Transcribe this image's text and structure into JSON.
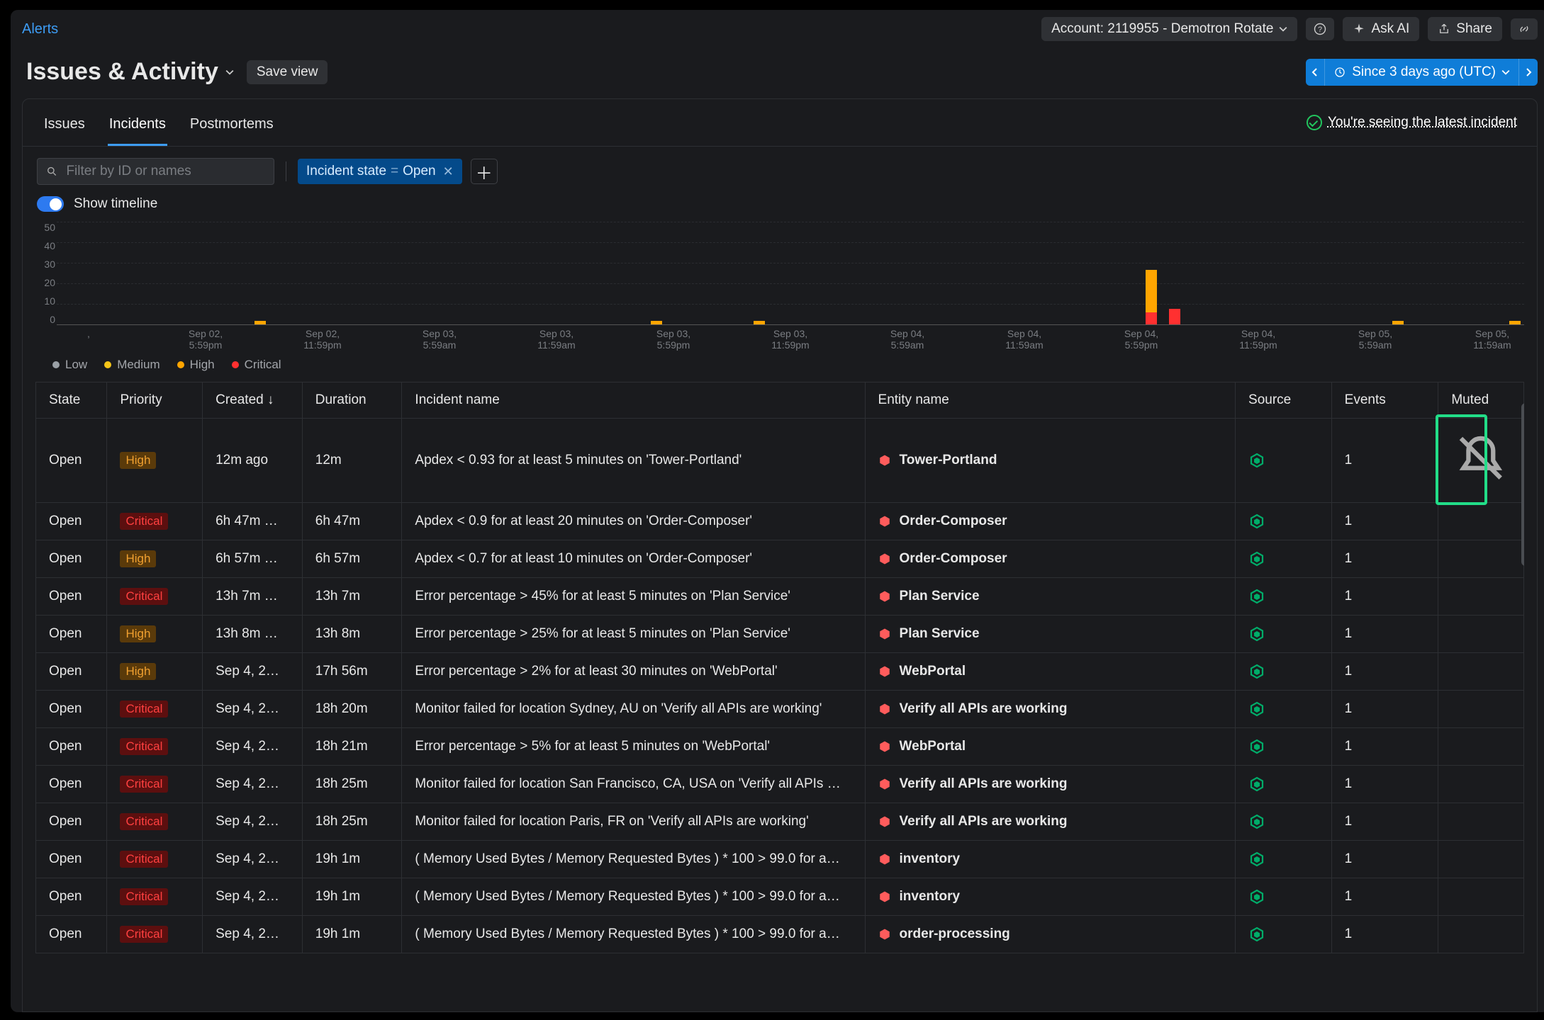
{
  "header": {
    "alerts_link": "Alerts",
    "account_selector": "Account: 2119955 - Demotron Rotate",
    "ask_ai": "Ask AI",
    "share": "Share"
  },
  "title": {
    "page_title": "Issues & Activity",
    "save_view": "Save view",
    "timerange": "Since 3 days ago (UTC)"
  },
  "tabs": {
    "issues": "Issues",
    "incidents": "Incidents",
    "postmortems": "Postmortems",
    "latest_notice": "You're seeing the latest incident"
  },
  "filters": {
    "search_placeholder": "Filter by ID or names",
    "chip_key": "Incident state",
    "chip_op": "=",
    "chip_val": "Open",
    "show_timeline": "Show timeline"
  },
  "chart_data": {
    "type": "bar",
    "y_ticks": [
      "50",
      "40",
      "30",
      "20",
      "10",
      "0"
    ],
    "x_ticks": [
      ",",
      "Sep 02, 5:59pm",
      "Sep 02, 11:59pm",
      "Sep 03, 5:59am",
      "Sep 03, 11:59am",
      "Sep 03, 5:59pm",
      "Sep 03, 11:59pm",
      "Sep 04, 5:59am",
      "Sep 04, 11:59am",
      "Sep 04, 5:59pm",
      "Sep 04, 11:59pm",
      "Sep 05, 5:59am",
      "Sep 05, 11:59am"
    ],
    "bars": [
      {
        "x_pct": 13.5,
        "stacks": [
          {
            "color": "#ffa500",
            "h": 4
          }
        ]
      },
      {
        "x_pct": 40.5,
        "stacks": [
          {
            "color": "#ffa500",
            "h": 4
          }
        ]
      },
      {
        "x_pct": 47.5,
        "stacks": [
          {
            "color": "#ffa500",
            "h": 4
          }
        ]
      },
      {
        "x_pct": 74.2,
        "stacks": [
          {
            "color": "#ffa500",
            "h": 50
          },
          {
            "color": "#ff3030",
            "h": 14
          }
        ]
      },
      {
        "x_pct": 75.8,
        "stacks": [
          {
            "color": "#ff3030",
            "h": 18
          }
        ]
      },
      {
        "x_pct": 91.0,
        "stacks": [
          {
            "color": "#ffa500",
            "h": 4
          }
        ]
      },
      {
        "x_pct": 99.0,
        "stacks": [
          {
            "color": "#ffa500",
            "h": 4
          }
        ]
      }
    ],
    "legend": [
      {
        "color": "#9aa0a6",
        "label": "Low"
      },
      {
        "color": "#f5c518",
        "label": "Medium"
      },
      {
        "color": "#ffa500",
        "label": "High"
      },
      {
        "color": "#ff3030",
        "label": "Critical"
      }
    ]
  },
  "columns": {
    "state": "State",
    "priority": "Priority",
    "created": "Created ↓",
    "duration": "Duration",
    "incident": "Incident name",
    "entity": "Entity name",
    "source": "Source",
    "events": "Events",
    "muted": "Muted"
  },
  "rows": [
    {
      "state": "Open",
      "priority": "High",
      "created": "12m ago",
      "duration": "12m",
      "name": "Apdex < 0.93 for at least 5 minutes on 'Tower-Portland'",
      "entity": "Tower-Portland",
      "events": "1",
      "muted": true
    },
    {
      "state": "Open",
      "priority": "Critical",
      "created": "6h 47m …",
      "duration": "6h 47m",
      "name": "Apdex < 0.9 for at least 20 minutes on 'Order-Composer'",
      "entity": "Order-Composer",
      "events": "1"
    },
    {
      "state": "Open",
      "priority": "High",
      "created": "6h 57m …",
      "duration": "6h 57m",
      "name": "Apdex < 0.7 for at least 10 minutes on 'Order-Composer'",
      "entity": "Order-Composer",
      "events": "1"
    },
    {
      "state": "Open",
      "priority": "Critical",
      "created": "13h 7m …",
      "duration": "13h 7m",
      "name": "Error percentage > 45% for at least 5 minutes on 'Plan Service'",
      "entity": "Plan Service",
      "events": "1"
    },
    {
      "state": "Open",
      "priority": "High",
      "created": "13h 8m …",
      "duration": "13h 8m",
      "name": "Error percentage > 25% for at least 5 minutes on 'Plan Service'",
      "entity": "Plan Service",
      "events": "1"
    },
    {
      "state": "Open",
      "priority": "High",
      "created": "Sep 4, 2…",
      "duration": "17h 56m",
      "name": "Error percentage > 2% for at least 30 minutes on 'WebPortal'",
      "entity": "WebPortal",
      "events": "1"
    },
    {
      "state": "Open",
      "priority": "Critical",
      "created": "Sep 4, 2…",
      "duration": "18h 20m",
      "name": "Monitor failed for location Sydney, AU on 'Verify all APIs are working'",
      "entity": "Verify all APIs are working",
      "events": "1"
    },
    {
      "state": "Open",
      "priority": "Critical",
      "created": "Sep 4, 2…",
      "duration": "18h 21m",
      "name": "Error percentage > 5% for at least 5 minutes on 'WebPortal'",
      "entity": "WebPortal",
      "events": "1"
    },
    {
      "state": "Open",
      "priority": "Critical",
      "created": "Sep 4, 2…",
      "duration": "18h 25m",
      "name": "Monitor failed for location San Francisco, CA, USA on 'Verify all APIs …",
      "entity": "Verify all APIs are working",
      "events": "1"
    },
    {
      "state": "Open",
      "priority": "Critical",
      "created": "Sep 4, 2…",
      "duration": "18h 25m",
      "name": "Monitor failed for location Paris, FR on 'Verify all APIs are working'",
      "entity": "Verify all APIs are working",
      "events": "1"
    },
    {
      "state": "Open",
      "priority": "Critical",
      "created": "Sep 4, 2…",
      "duration": "19h 1m",
      "name": "( Memory Used Bytes / Memory Requested Bytes ) * 100 > 99.0 for a…",
      "entity": "inventory",
      "events": "1"
    },
    {
      "state": "Open",
      "priority": "Critical",
      "created": "Sep 4, 2…",
      "duration": "19h 1m",
      "name": "( Memory Used Bytes / Memory Requested Bytes ) * 100 > 99.0 for a…",
      "entity": "inventory",
      "events": "1"
    },
    {
      "state": "Open",
      "priority": "Critical",
      "created": "Sep 4, 2…",
      "duration": "19h 1m",
      "name": "( Memory Used Bytes / Memory Requested Bytes ) * 100 > 99.0 for a…",
      "entity": "order-processing",
      "events": "1"
    }
  ]
}
